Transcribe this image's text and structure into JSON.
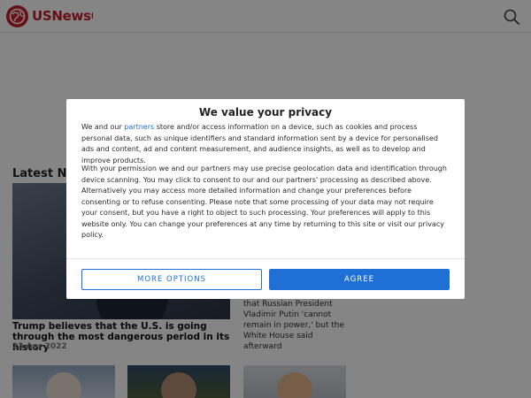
{
  "site": {
    "logo_text": "USNewsON",
    "brand_color": "#c8202c"
  },
  "header": {
    "search_icon": "search-icon"
  },
  "main": {
    "section_title": "Latest News",
    "hero": {
      "title": "Trump believes that the U.S. is going through the most dangerous period in its history",
      "date": "23 Apr 2022"
    },
    "side_story": {
      "text": "that Russian President Vladimir Putin 'cannot remain in power,' but the White House said afterward"
    }
  },
  "consent": {
    "title": "We value your privacy",
    "p1_before": "We and our ",
    "p1_link": "partners",
    "p1_after": " store and/or access information on a device, such as cookies and process personal data, such as unique identifiers and standard information sent by a device for personalised ads and content, ad and content measurement, and audience insights, as well as to develop and improve products.",
    "p2": "With your permission we and our partners may use precise geolocation data and identification through device scanning. You may click to consent to our and our partners' processing as described above. Alternatively you may access more detailed information and change your preferences before consenting or to refuse consenting. Please note that some processing of your data may not require your consent, but you have a right to object to such processing. Your preferences will apply to this website only. You can change your preferences at any time by returning to this site or visit our privacy policy.",
    "more_options_label": "MORE OPTIONS",
    "agree_label": "AGREE",
    "accent_color": "#1e6fd6"
  }
}
